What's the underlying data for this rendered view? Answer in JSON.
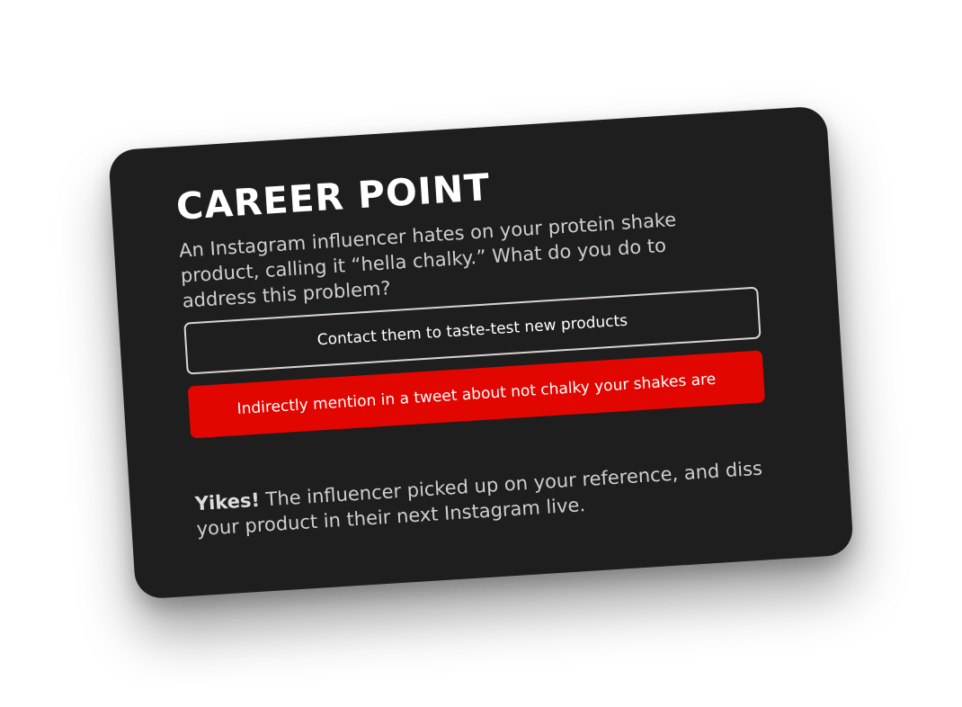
{
  "card": {
    "title": "CAREER POINT",
    "question": "An Instagram influencer hates on your protein shake product, calling it “hella chalky.” What do you do to address this problem?",
    "options": [
      {
        "label": "Contact them to taste-test new products",
        "selected": false
      },
      {
        "label": "Indirectly mention in a tweet about not chalky your shakes are",
        "selected": true
      }
    ],
    "feedback": {
      "emphasis": "Yikes!",
      "text": " The influencer picked up on your reference, and diss your product in their next Instagram live."
    }
  },
  "colors": {
    "card_background": "#1e1e1e",
    "selected_option": "#e10600",
    "text_primary": "#ffffff",
    "text_secondary": "#cfcfcf"
  }
}
